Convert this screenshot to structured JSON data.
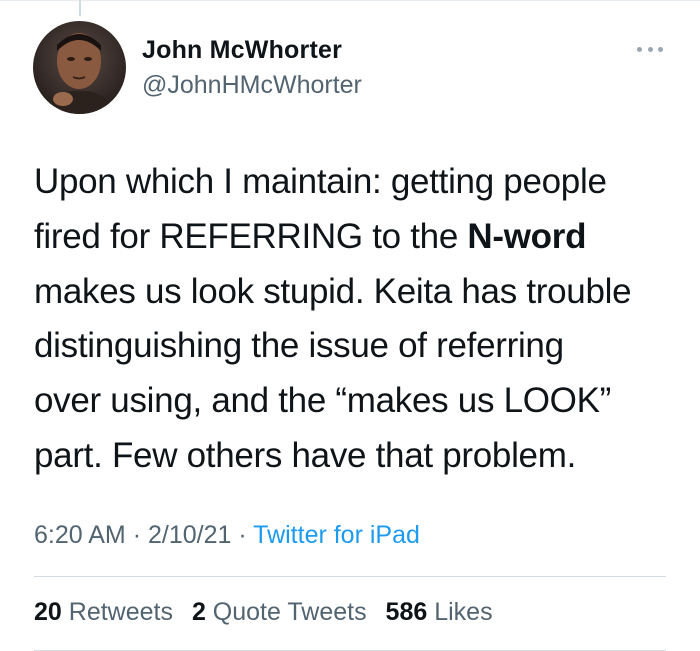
{
  "author": {
    "name": "John McWhorter",
    "handle": "@JohnHMcWhorter"
  },
  "tweet": {
    "lines": [
      "Upon which I maintain: getting people",
      "fired for REFERRING to the ",
      "makes us look stupid. Keita has trouble",
      "distinguishing the issue of referring",
      "over using, and the “makes us LOOK”",
      "part. Few others have that problem."
    ],
    "bold_term": "N-word"
  },
  "meta": {
    "time": "6:20 AM",
    "separator": "·",
    "date": "2/10/21",
    "source": "Twitter for iPad"
  },
  "stats": {
    "retweets_count": "20",
    "retweets_label": "Retweets",
    "quotes_count": "2",
    "quotes_label": "Quote Tweets",
    "likes_count": "586",
    "likes_label": "Likes"
  },
  "icons": {
    "more": "more-options-icon"
  },
  "colors": {
    "text": "#0f1419",
    "secondary": "#536471",
    "link": "#1d9bf0"
  }
}
